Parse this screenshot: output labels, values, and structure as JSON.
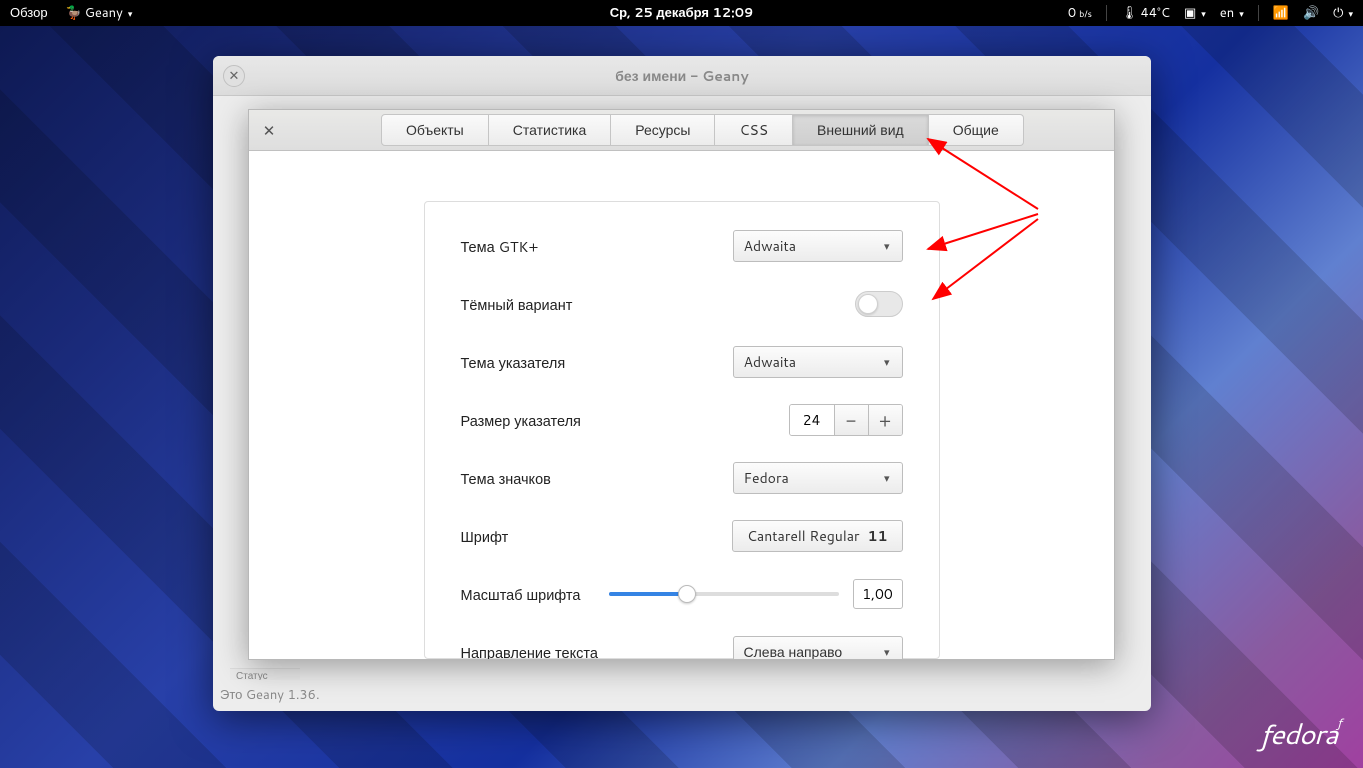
{
  "topbar": {
    "overview": "Обзор",
    "app": "Geany",
    "datetime": "Ср, 25 декабря  12:09",
    "net_speed": "0",
    "net_unit": "b/s",
    "temp": "44°C",
    "lang": "en"
  },
  "window": {
    "title": "без имени - Geany",
    "status_tab": "Статус",
    "statusbar": "Это Geany 1.36."
  },
  "inspector": {
    "tabs": [
      "Объекты",
      "Статистика",
      "Ресурсы",
      "CSS",
      "Внешний вид",
      "Общие"
    ],
    "active_tab": 4
  },
  "settings": {
    "gtk_theme": {
      "label": "Тема GTK+",
      "value": "Adwaita"
    },
    "dark_variant": {
      "label": "Тёмный вариант",
      "on": false
    },
    "cursor_theme": {
      "label": "Тема указателя",
      "value": "Adwaita"
    },
    "cursor_size": {
      "label": "Размер указателя",
      "value": "24"
    },
    "icon_theme": {
      "label": "Тема значков",
      "value": "Fedora"
    },
    "font": {
      "label": "Шрифт",
      "value": "Cantarell Regular",
      "size": "11"
    },
    "font_scale": {
      "label": "Масштаб шрифта",
      "value": "1,00"
    },
    "text_dir": {
      "label": "Направление текста",
      "value": "Слева направо"
    }
  },
  "logo": "fedora"
}
